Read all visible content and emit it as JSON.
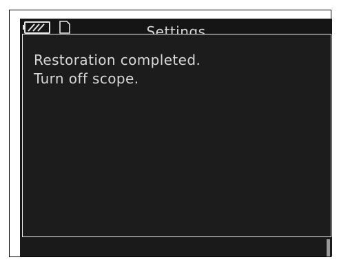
{
  "header": {
    "title": "Settings",
    "battery_icon": "battery-icon",
    "card_icon": "memory-card-icon"
  },
  "dialog": {
    "line1": "Restoration completed.",
    "line2": "Turn off scope."
  },
  "colors": {
    "screen_background": "#151515",
    "text": "#d8d8d8",
    "dialog_border": "#f0f0f0"
  }
}
